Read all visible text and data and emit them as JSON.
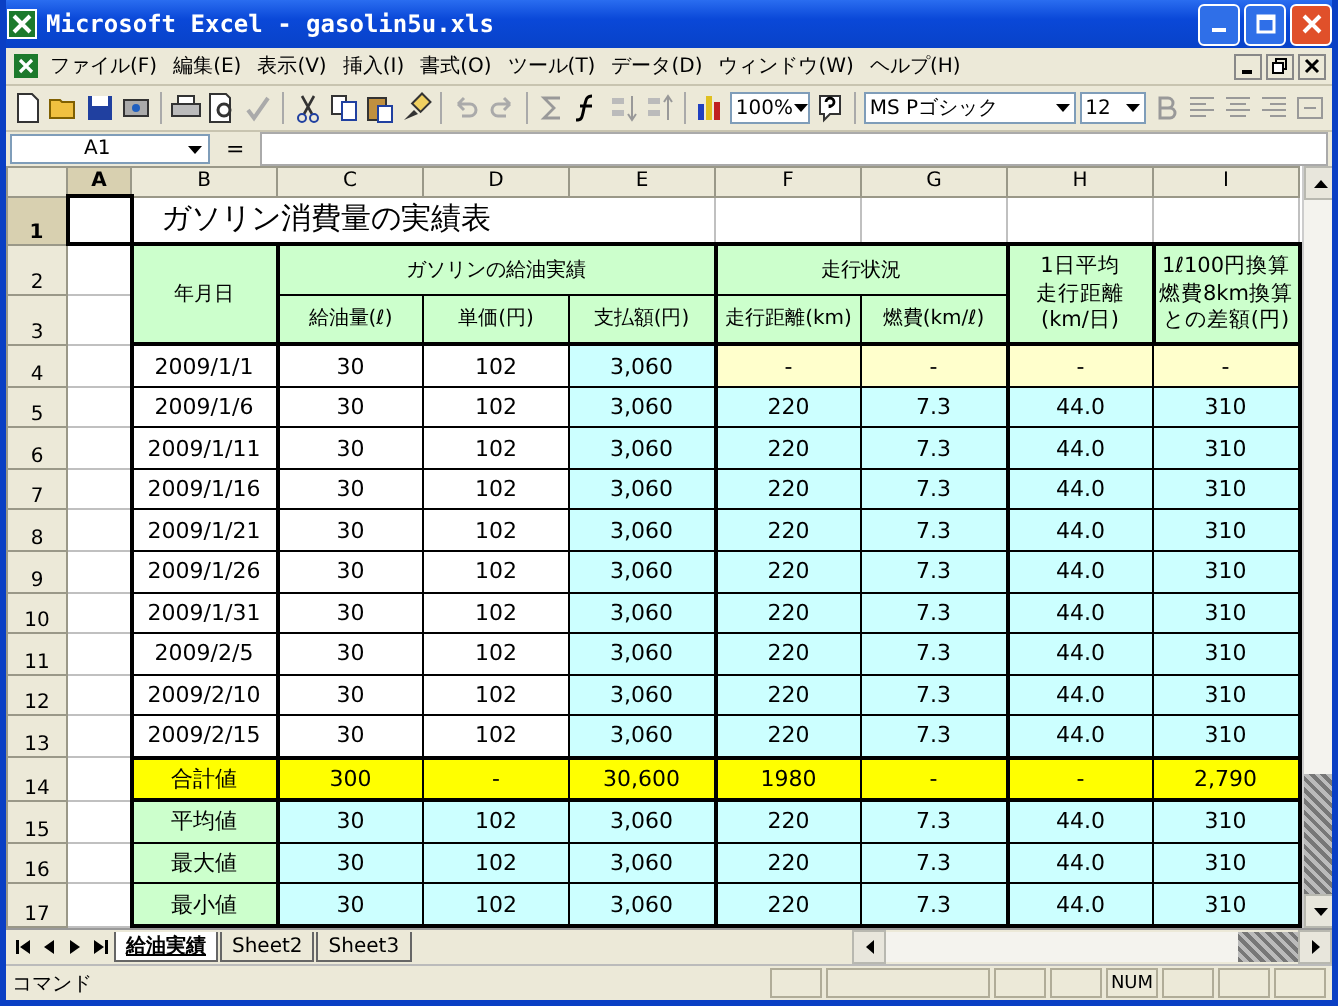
{
  "window": {
    "title": "Microsoft Excel - gasolin5u.xls"
  },
  "menu": [
    "ファイル(F)",
    "編集(E)",
    "表示(V)",
    "挿入(I)",
    "書式(O)",
    "ツール(T)",
    "データ(D)",
    "ウィンドウ(W)",
    "ヘルプ(H)"
  ],
  "toolbar": {
    "zoom": "100%",
    "font": "MS Pゴシック",
    "size": "12"
  },
  "formula_bar": {
    "name_box": "A1",
    "equals": "="
  },
  "columns": [
    "A",
    "B",
    "C",
    "D",
    "E",
    "F",
    "G",
    "H",
    "I"
  ],
  "row_numbers": [
    "1",
    "2",
    "3",
    "4",
    "5",
    "6",
    "7",
    "8",
    "9",
    "10",
    "11",
    "12",
    "13",
    "14",
    "15",
    "16",
    "17"
  ],
  "sheet": {
    "title": "ガソリン消費量の実績表",
    "date_header": "年月日",
    "group_1": "ガソリンの給油実績",
    "group_2": "走行状況",
    "sub_headers": [
      "給油量(ℓ)",
      "単価(円)",
      "支払額(円)",
      "走行距離(km)",
      "燃費(km/ℓ)"
    ],
    "header_h": [
      "1日平均",
      "走行距離",
      "(km/日)"
    ],
    "header_i": [
      "1ℓ100円換算",
      "燃費8km換算",
      "との差額(円)"
    ],
    "rows": [
      {
        "kind": "first",
        "cells": [
          "2009/1/1",
          "30",
          "102",
          "3,060",
          "-",
          "-",
          "-",
          "-"
        ]
      },
      {
        "kind": "data",
        "cells": [
          "2009/1/6",
          "30",
          "102",
          "3,060",
          "220",
          "7.3",
          "44.0",
          "310"
        ]
      },
      {
        "kind": "data",
        "cells": [
          "2009/1/11",
          "30",
          "102",
          "3,060",
          "220",
          "7.3",
          "44.0",
          "310"
        ]
      },
      {
        "kind": "data",
        "cells": [
          "2009/1/16",
          "30",
          "102",
          "3,060",
          "220",
          "7.3",
          "44.0",
          "310"
        ]
      },
      {
        "kind": "data",
        "cells": [
          "2009/1/21",
          "30",
          "102",
          "3,060",
          "220",
          "7.3",
          "44.0",
          "310"
        ]
      },
      {
        "kind": "data",
        "cells": [
          "2009/1/26",
          "30",
          "102",
          "3,060",
          "220",
          "7.3",
          "44.0",
          "310"
        ]
      },
      {
        "kind": "data",
        "cells": [
          "2009/1/31",
          "30",
          "102",
          "3,060",
          "220",
          "7.3",
          "44.0",
          "310"
        ]
      },
      {
        "kind": "data",
        "cells": [
          "2009/2/5",
          "30",
          "102",
          "3,060",
          "220",
          "7.3",
          "44.0",
          "310"
        ]
      },
      {
        "kind": "data",
        "cells": [
          "2009/2/10",
          "30",
          "102",
          "3,060",
          "220",
          "7.3",
          "44.0",
          "310"
        ]
      },
      {
        "kind": "data",
        "cells": [
          "2009/2/15",
          "30",
          "102",
          "3,060",
          "220",
          "7.3",
          "44.0",
          "310"
        ]
      },
      {
        "kind": "total",
        "cells": [
          "合計値",
          "300",
          "-",
          "30,600",
          "1980",
          "-",
          "-",
          "2,790"
        ]
      },
      {
        "kind": "stat",
        "cells": [
          "平均値",
          "30",
          "102",
          "3,060",
          "220",
          "7.3",
          "44.0",
          "310"
        ]
      },
      {
        "kind": "stat",
        "cells": [
          "最大値",
          "30",
          "102",
          "3,060",
          "220",
          "7.3",
          "44.0",
          "310"
        ]
      },
      {
        "kind": "stat",
        "cells": [
          "最小値",
          "30",
          "102",
          "3,060",
          "220",
          "7.3",
          "44.0",
          "310"
        ]
      }
    ]
  },
  "sheet_tabs": [
    {
      "label": "給油実績",
      "selected": true
    },
    {
      "label": "Sheet2",
      "selected": false
    },
    {
      "label": "Sheet3",
      "selected": false
    }
  ],
  "status_bar": {
    "text": "コマンド",
    "num": "NUM"
  }
}
